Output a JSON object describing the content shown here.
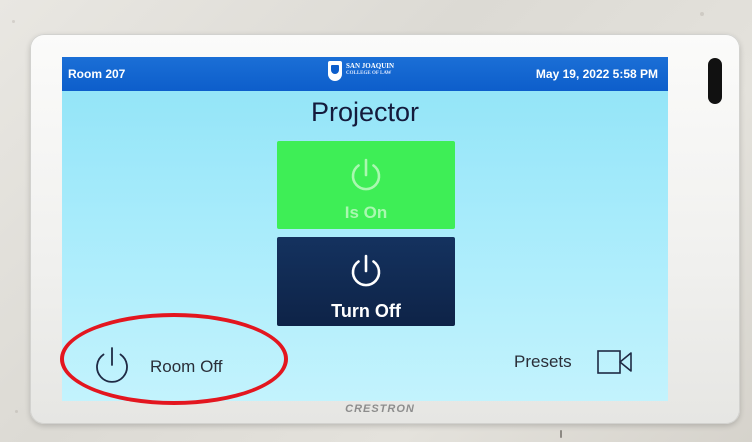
{
  "topbar": {
    "room_name": "Room 207",
    "datetime": "May 19, 2022 5:58 PM",
    "logo": {
      "line1": "SAN JOAQUIN",
      "line2": "COLLEGE OF LAW",
      "icon": "shield-icon"
    }
  },
  "main": {
    "title": "Projector",
    "power_status_button": {
      "label": "Is On",
      "icon": "power-icon",
      "color": "#3eee56"
    },
    "turn_off_button": {
      "label": "Turn Off",
      "icon": "power-icon",
      "color": "#14325f"
    }
  },
  "footer": {
    "room_off": {
      "label": "Room Off",
      "icon": "power-icon"
    },
    "presets": {
      "label": "Presets",
      "icon": "camera-icon"
    }
  },
  "device": {
    "brand": "CRESTRON"
  },
  "colors": {
    "topbar": "#0d5ecb",
    "screen_background": "#a6ebfb",
    "annotation_circle": "#e3161f"
  }
}
